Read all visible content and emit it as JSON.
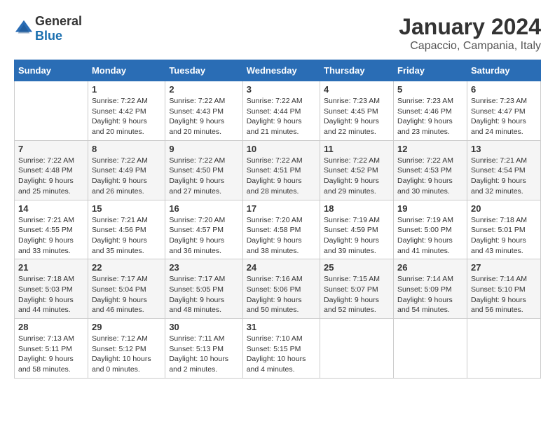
{
  "logo": {
    "general": "General",
    "blue": "Blue"
  },
  "title": "January 2024",
  "subtitle": "Capaccio, Campania, Italy",
  "days_header": [
    "Sunday",
    "Monday",
    "Tuesday",
    "Wednesday",
    "Thursday",
    "Friday",
    "Saturday"
  ],
  "weeks": [
    [
      {
        "day": "",
        "info": ""
      },
      {
        "day": "1",
        "info": "Sunrise: 7:22 AM\nSunset: 4:42 PM\nDaylight: 9 hours\nand 20 minutes."
      },
      {
        "day": "2",
        "info": "Sunrise: 7:22 AM\nSunset: 4:43 PM\nDaylight: 9 hours\nand 20 minutes."
      },
      {
        "day": "3",
        "info": "Sunrise: 7:22 AM\nSunset: 4:44 PM\nDaylight: 9 hours\nand 21 minutes."
      },
      {
        "day": "4",
        "info": "Sunrise: 7:23 AM\nSunset: 4:45 PM\nDaylight: 9 hours\nand 22 minutes."
      },
      {
        "day": "5",
        "info": "Sunrise: 7:23 AM\nSunset: 4:46 PM\nDaylight: 9 hours\nand 23 minutes."
      },
      {
        "day": "6",
        "info": "Sunrise: 7:23 AM\nSunset: 4:47 PM\nDaylight: 9 hours\nand 24 minutes."
      }
    ],
    [
      {
        "day": "7",
        "info": "Sunrise: 7:22 AM\nSunset: 4:48 PM\nDaylight: 9 hours\nand 25 minutes."
      },
      {
        "day": "8",
        "info": "Sunrise: 7:22 AM\nSunset: 4:49 PM\nDaylight: 9 hours\nand 26 minutes."
      },
      {
        "day": "9",
        "info": "Sunrise: 7:22 AM\nSunset: 4:50 PM\nDaylight: 9 hours\nand 27 minutes."
      },
      {
        "day": "10",
        "info": "Sunrise: 7:22 AM\nSunset: 4:51 PM\nDaylight: 9 hours\nand 28 minutes."
      },
      {
        "day": "11",
        "info": "Sunrise: 7:22 AM\nSunset: 4:52 PM\nDaylight: 9 hours\nand 29 minutes."
      },
      {
        "day": "12",
        "info": "Sunrise: 7:22 AM\nSunset: 4:53 PM\nDaylight: 9 hours\nand 30 minutes."
      },
      {
        "day": "13",
        "info": "Sunrise: 7:21 AM\nSunset: 4:54 PM\nDaylight: 9 hours\nand 32 minutes."
      }
    ],
    [
      {
        "day": "14",
        "info": "Sunrise: 7:21 AM\nSunset: 4:55 PM\nDaylight: 9 hours\nand 33 minutes."
      },
      {
        "day": "15",
        "info": "Sunrise: 7:21 AM\nSunset: 4:56 PM\nDaylight: 9 hours\nand 35 minutes."
      },
      {
        "day": "16",
        "info": "Sunrise: 7:20 AM\nSunset: 4:57 PM\nDaylight: 9 hours\nand 36 minutes."
      },
      {
        "day": "17",
        "info": "Sunrise: 7:20 AM\nSunset: 4:58 PM\nDaylight: 9 hours\nand 38 minutes."
      },
      {
        "day": "18",
        "info": "Sunrise: 7:19 AM\nSunset: 4:59 PM\nDaylight: 9 hours\nand 39 minutes."
      },
      {
        "day": "19",
        "info": "Sunrise: 7:19 AM\nSunset: 5:00 PM\nDaylight: 9 hours\nand 41 minutes."
      },
      {
        "day": "20",
        "info": "Sunrise: 7:18 AM\nSunset: 5:01 PM\nDaylight: 9 hours\nand 43 minutes."
      }
    ],
    [
      {
        "day": "21",
        "info": "Sunrise: 7:18 AM\nSunset: 5:03 PM\nDaylight: 9 hours\nand 44 minutes."
      },
      {
        "day": "22",
        "info": "Sunrise: 7:17 AM\nSunset: 5:04 PM\nDaylight: 9 hours\nand 46 minutes."
      },
      {
        "day": "23",
        "info": "Sunrise: 7:17 AM\nSunset: 5:05 PM\nDaylight: 9 hours\nand 48 minutes."
      },
      {
        "day": "24",
        "info": "Sunrise: 7:16 AM\nSunset: 5:06 PM\nDaylight: 9 hours\nand 50 minutes."
      },
      {
        "day": "25",
        "info": "Sunrise: 7:15 AM\nSunset: 5:07 PM\nDaylight: 9 hours\nand 52 minutes."
      },
      {
        "day": "26",
        "info": "Sunrise: 7:14 AM\nSunset: 5:09 PM\nDaylight: 9 hours\nand 54 minutes."
      },
      {
        "day": "27",
        "info": "Sunrise: 7:14 AM\nSunset: 5:10 PM\nDaylight: 9 hours\nand 56 minutes."
      }
    ],
    [
      {
        "day": "28",
        "info": "Sunrise: 7:13 AM\nSunset: 5:11 PM\nDaylight: 9 hours\nand 58 minutes."
      },
      {
        "day": "29",
        "info": "Sunrise: 7:12 AM\nSunset: 5:12 PM\nDaylight: 10 hours\nand 0 minutes."
      },
      {
        "day": "30",
        "info": "Sunrise: 7:11 AM\nSunset: 5:13 PM\nDaylight: 10 hours\nand 2 minutes."
      },
      {
        "day": "31",
        "info": "Sunrise: 7:10 AM\nSunset: 5:15 PM\nDaylight: 10 hours\nand 4 minutes."
      },
      {
        "day": "",
        "info": ""
      },
      {
        "day": "",
        "info": ""
      },
      {
        "day": "",
        "info": ""
      }
    ]
  ]
}
